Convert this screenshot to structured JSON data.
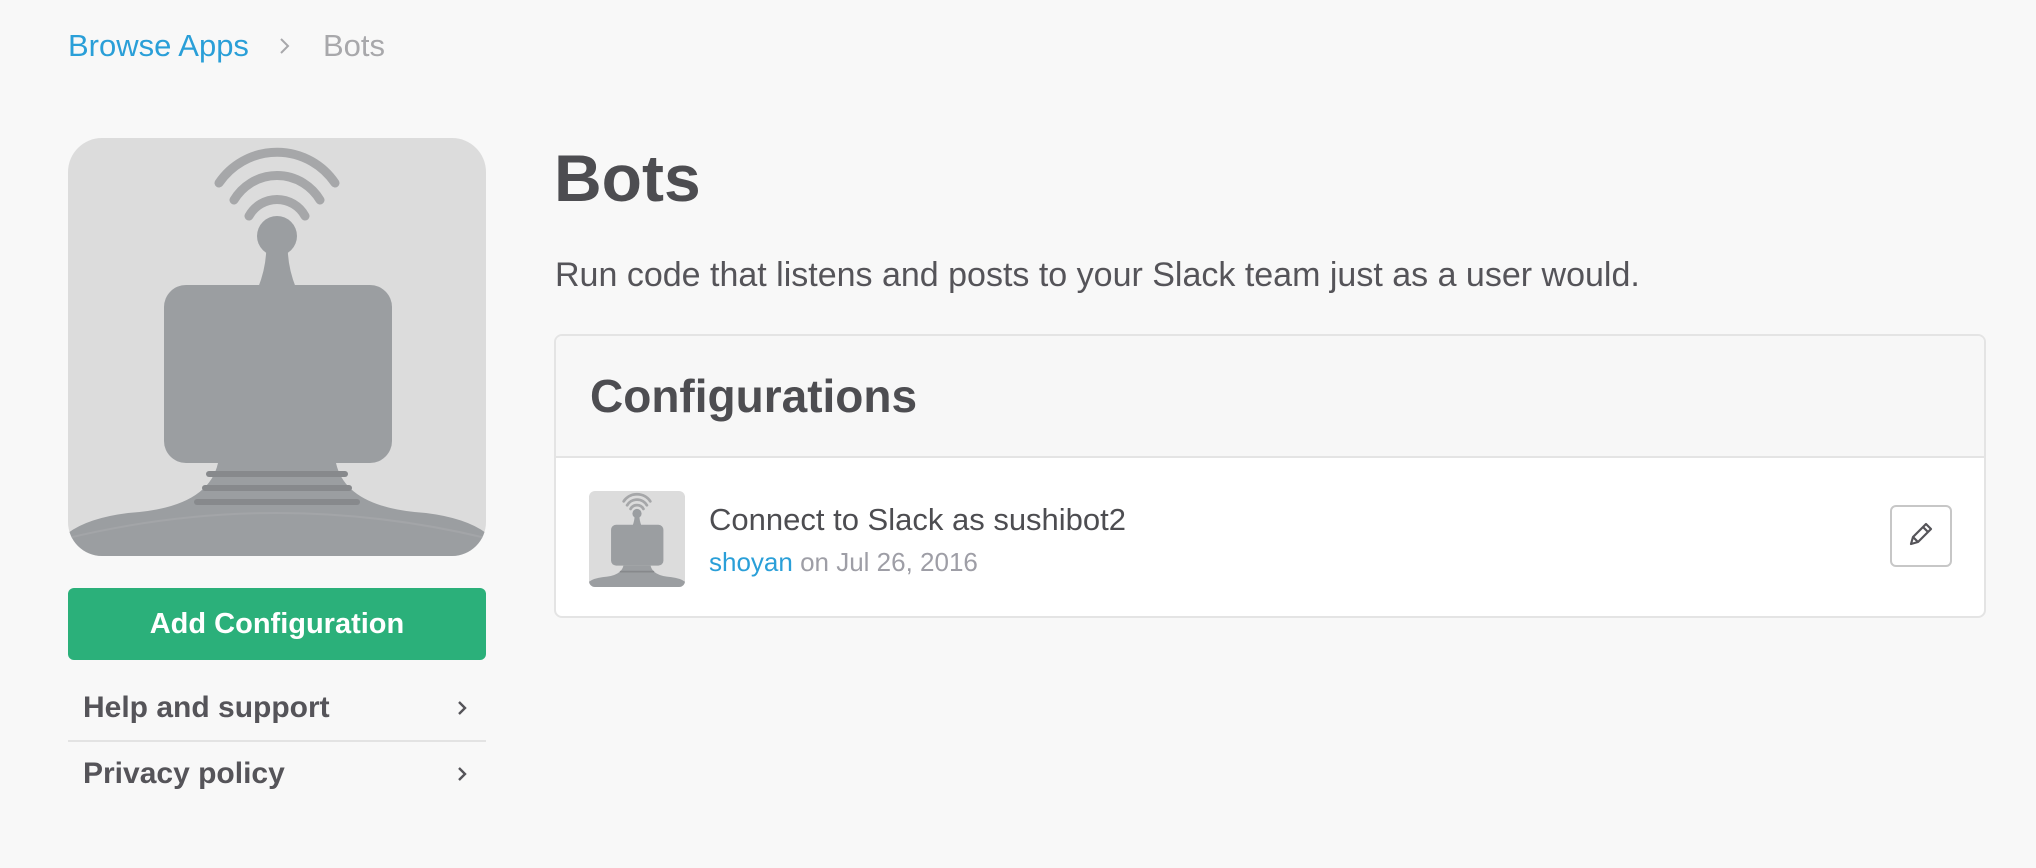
{
  "breadcrumb": {
    "parent": "Browse Apps",
    "current": "Bots"
  },
  "app": {
    "title": "Bots",
    "description": "Run code that listens and posts to your Slack team just as a user would."
  },
  "sidebar": {
    "add_button": "Add Configuration",
    "links": [
      {
        "label": "Help and support",
        "icon": "chevron-right-icon"
      },
      {
        "label": "Privacy policy",
        "icon": "chevron-right-icon"
      }
    ]
  },
  "configurations": {
    "heading": "Configurations",
    "items": [
      {
        "title": "Connect to Slack as sushibot2",
        "user": "shoyan",
        "date_text": " on Jul 26, 2016",
        "edit_icon": "pencil-icon"
      }
    ]
  },
  "colors": {
    "accent_link": "#2a9fd8",
    "primary_button": "#2bb07a",
    "background": "#f8f8f8"
  }
}
